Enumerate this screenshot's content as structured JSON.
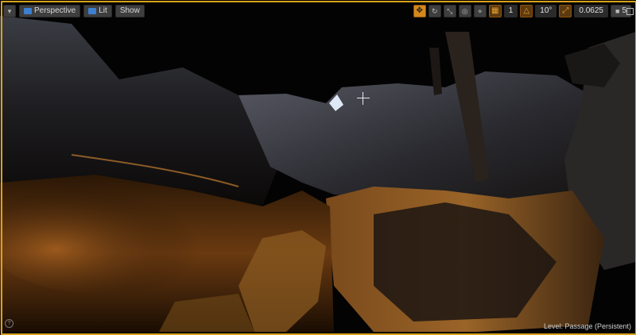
{
  "toolbar_left": {
    "menu_icon": "chevron-down-icon",
    "perspective_label": "Perspective",
    "lit_label": "Lit",
    "show_label": "Show"
  },
  "toolbar_right": {
    "grid_snap_value": "1",
    "rotation_snap_value": "10°",
    "scale_snap_value": "0.0625",
    "camera_speed_value": "5"
  },
  "status": {
    "level_label": "Level:  Passage (Persistent)"
  },
  "colors": {
    "viewport_frame": "#d9a21b",
    "active_snap": "#d4881c"
  }
}
